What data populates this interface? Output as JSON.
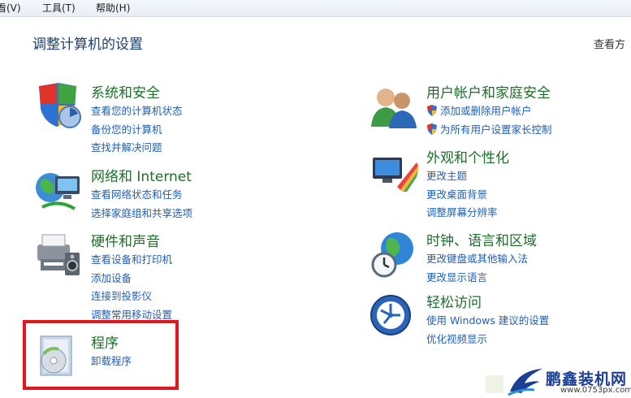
{
  "menubar": {
    "view": "看(V)",
    "tools": "工具(T)",
    "help": "帮助(H)"
  },
  "page_title": "调整计算机的设置",
  "view_by": "查看方",
  "left_categories": [
    {
      "title": "系统和安全",
      "icon": "system-security-icon",
      "links": [
        "查看您的计算机状态",
        "备份您的计算机",
        "查找并解决问题"
      ]
    },
    {
      "title": "网络和 Internet",
      "icon": "network-internet-icon",
      "links": [
        "查看网络状态和任务",
        "选择家庭组和共享选项"
      ]
    },
    {
      "title": "硬件和声音",
      "icon": "hardware-sound-icon",
      "links": [
        "查看设备和打印机",
        "添加设备",
        "连接到投影仪",
        "调整常用移动设置"
      ]
    },
    {
      "title": "程序",
      "icon": "programs-icon",
      "links": [
        "卸载程序"
      ]
    }
  ],
  "right_categories": [
    {
      "title": "用户帐户和家庭安全",
      "icon": "user-accounts-icon",
      "links": [
        "添加或删除用户帐户",
        "为所有用户设置家长控制"
      ]
    },
    {
      "title": "外观和个性化",
      "icon": "appearance-icon",
      "links": [
        "更改主题",
        "更改桌面背景",
        "调整屏幕分辨率"
      ]
    },
    {
      "title": "时钟、语言和区域",
      "icon": "clock-language-region-icon",
      "links": [
        "更改键盘或其他输入法",
        "更改显示语言"
      ]
    },
    {
      "title": "轻松访问",
      "icon": "ease-of-access-icon",
      "links": [
        "使用 Windows 建议的设置",
        "优化视频显示"
      ]
    }
  ],
  "watermark": {
    "name": "鹏鑫装机网",
    "url": "www.0753px.com"
  },
  "colors": {
    "category_title": "#1e6e2a",
    "link": "#1f5fb2",
    "highlight": "#e2161b",
    "page_title": "#1a3e6e"
  }
}
